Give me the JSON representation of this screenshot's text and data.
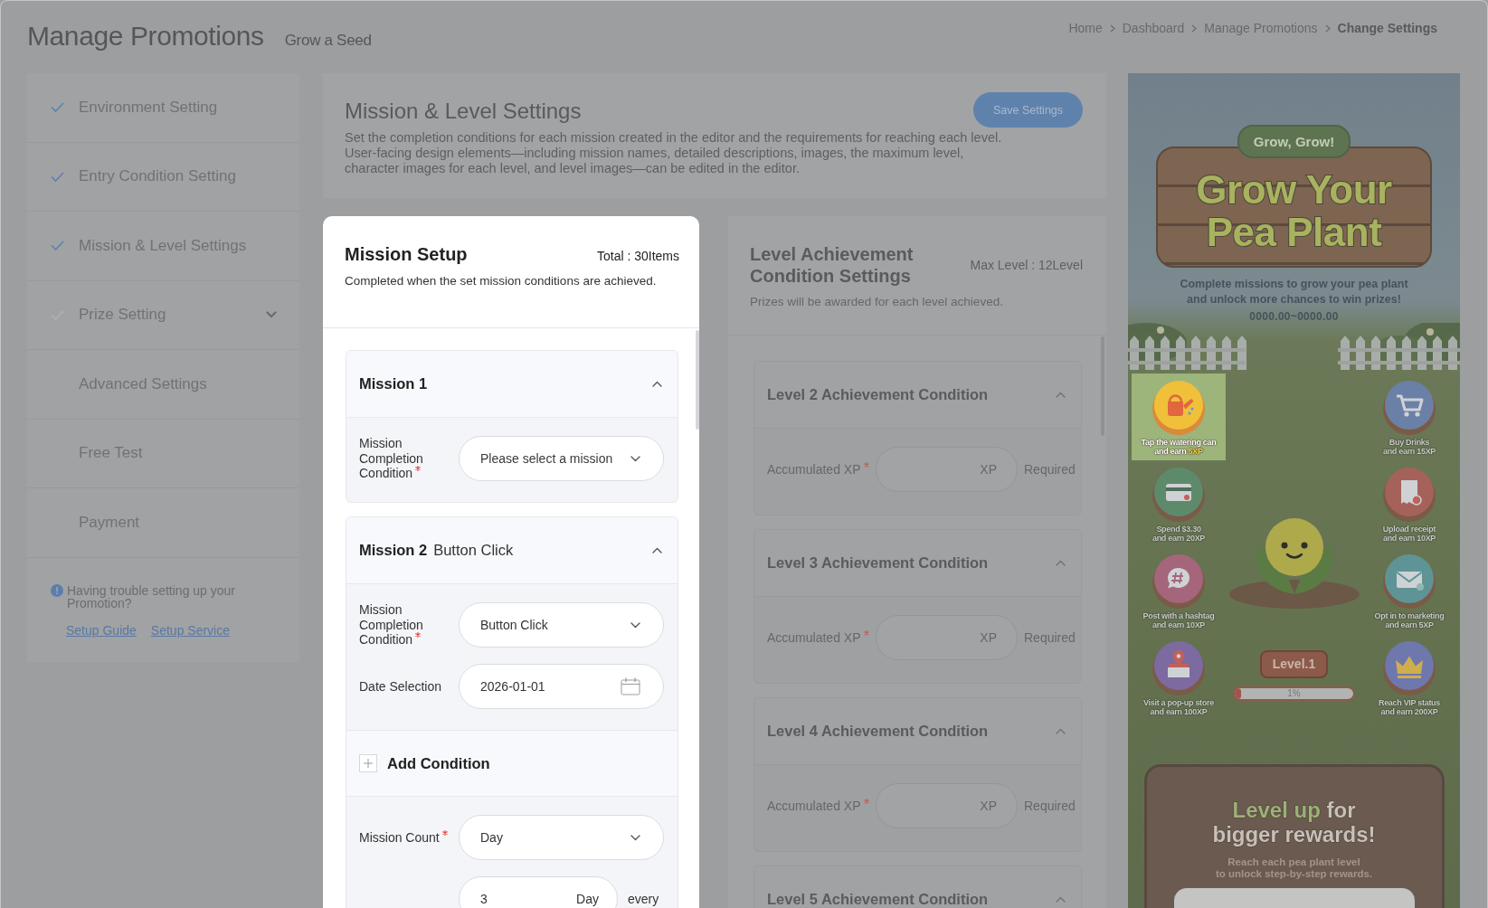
{
  "header": {
    "title": "Manage Promotions",
    "subtitle": "Grow a Seed"
  },
  "breadcrumb": [
    {
      "label": "Home",
      "current": false
    },
    {
      "label": "Dashboard",
      "current": false
    },
    {
      "label": "Manage Promotions",
      "current": false
    },
    {
      "label": "Change Settings",
      "current": true
    }
  ],
  "sidebar": {
    "items": [
      {
        "label": "Environment Setting",
        "kind": "step",
        "checked": true,
        "has_submenu": false
      },
      {
        "label": "Entry Condition Setting",
        "kind": "step",
        "checked": true,
        "has_submenu": false
      },
      {
        "label": "Mission & Level Settings",
        "kind": "step",
        "checked": true,
        "has_submenu": false
      },
      {
        "label": "Prize Setting",
        "kind": "step",
        "checked": false,
        "has_submenu": true
      },
      {
        "label": "Advanced Settings",
        "kind": "page",
        "checked": false,
        "has_submenu": false
      },
      {
        "label": "Free Test",
        "kind": "page",
        "checked": false,
        "has_submenu": false
      },
      {
        "label": "Payment",
        "kind": "page",
        "checked": false,
        "has_submenu": false
      }
    ],
    "help": {
      "text": "Having trouble setting up your Promotion?",
      "links": [
        "Setup Guide",
        "Setup Service"
      ]
    }
  },
  "settings": {
    "title": "Mission & Level Settings",
    "description": "Set the completion conditions for each mission created in the editor and the requirements for reaching each level.\nUser-facing design elements—including mission names, detailed descriptions, images, the maximum level, character images for each level, and level images—can be edited in the editor.",
    "save_button": "Save Settings"
  },
  "mission_setup": {
    "title": "Mission Setup",
    "total": "Total : 30Items",
    "subtitle": "Completed when the set mission conditions are achieved.",
    "missions": [
      {
        "title": "Mission 1",
        "expanded": true,
        "sections": [
          {
            "kind": "fields",
            "fields": [
              {
                "kind": "select",
                "label": "Mission Completion Condition",
                "required": true,
                "placeholder": "Please select a mission"
              }
            ]
          }
        ]
      },
      {
        "title": "Mission 2",
        "subtitle": "Button Click",
        "expanded": true,
        "sections": [
          {
            "kind": "fields",
            "fields": [
              {
                "kind": "select",
                "label": "Mission Completion Condition",
                "required": true,
                "value": "Button Click"
              },
              {
                "kind": "date",
                "label": "Date Selection",
                "required": false,
                "value": "2026-01-01"
              }
            ]
          },
          {
            "kind": "add",
            "label": "Add Condition"
          },
          {
            "kind": "fields",
            "fields": [
              {
                "kind": "select",
                "label": "Mission Count",
                "required": true,
                "value": "Day"
              },
              {
                "kind": "count",
                "value": "3",
                "unit": "Day",
                "suffix": "every"
              }
            ]
          }
        ]
      }
    ]
  },
  "level_setup": {
    "title": "Level Achievement Condition Settings",
    "max_level": "Max Level : 12Level",
    "subtitle": "Prizes will be awarded for each level achieved.",
    "levels": [
      {
        "title": "Level 2 Achievement Condition",
        "expanded": true,
        "field": {
          "label": "Accumulated XP",
          "required": true,
          "unit": "XP",
          "suffix": "Required"
        }
      },
      {
        "title": "Level 3 Achievement Condition",
        "expanded": true,
        "field": {
          "label": "Accumulated XP",
          "required": true,
          "unit": "XP",
          "suffix": "Required"
        }
      },
      {
        "title": "Level 4 Achievement Condition",
        "expanded": true,
        "field": {
          "label": "Accumulated XP",
          "required": true,
          "unit": "XP",
          "suffix": "Required"
        }
      },
      {
        "title": "Level 5 Achievement Condition",
        "expanded": true
      }
    ]
  },
  "preview": {
    "badge": "Grow, Grow!",
    "title": "Grow Your\nPea Plant",
    "description": "Complete missions to grow your pea plant\nand unlock more chances to win prizes!",
    "period": "0000.00~0000.00",
    "missions": [
      {
        "kind": "watering-can",
        "label": "Tap the watering can\nand earn **5XP**",
        "color": "#f0c03a",
        "selected": true
      },
      {
        "kind": "cart",
        "label": "Buy Drinks\nand earn 15XP",
        "color": "#6b80a6",
        "selected": false
      },
      {
        "kind": "card",
        "label": "Spend $3.30\nand earn 20XP",
        "color": "#5e8a6c",
        "selected": false
      },
      {
        "kind": "receipt",
        "label": "Upload receipt\nand earn 10XP",
        "color": "#a5625a",
        "selected": false
      },
      {
        "kind": "hashtag",
        "label": "Post with a hashtag\nand earn 10XP",
        "color": "#a5667c",
        "selected": false
      },
      {
        "kind": "envelope",
        "label": "Opt in to marketing\nand earn 5XP",
        "color": "#5f9496",
        "selected": false
      },
      {
        "kind": "store",
        "label": "Visit a pop-up store\nand earn 100XP",
        "color": "#7c6aa0",
        "selected": false
      },
      {
        "kind": "crown",
        "label": "Reach VIP status\nand earn 200XP",
        "color": "#6e78ad",
        "selected": false
      }
    ],
    "level_badge": "Level.1",
    "progress": {
      "level": 0.05,
      "label": "1%"
    },
    "reward": {
      "title": "**Level up** for\nbigger rewards!",
      "text": "Reach each pea plant level\nto unlock step-by-step rewards."
    }
  }
}
